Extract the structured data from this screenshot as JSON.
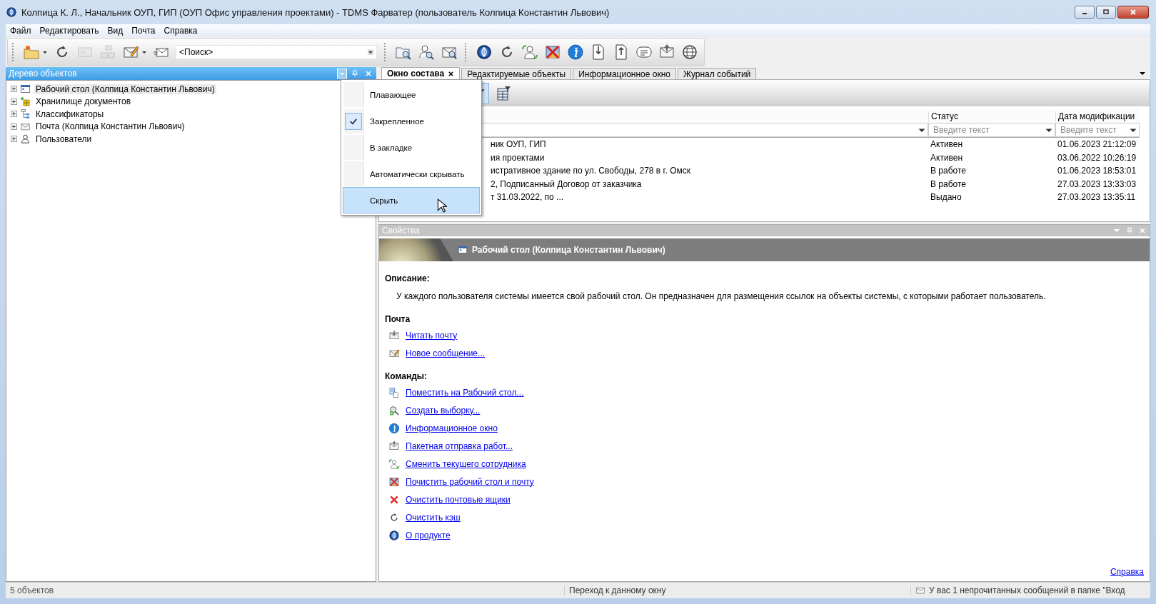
{
  "window": {
    "title": "Колпица К. Л., Начальник ОУП, ГИП (ОУП Офис управления проектами) - TDMS Фарватер (пользователь Колпица Константин Львович)"
  },
  "menu_bar": [
    "Файл",
    "Редактировать",
    "Вид",
    "Почта",
    "Справка"
  ],
  "toolbar": {
    "search": {
      "value": "<Поиск>"
    }
  },
  "object_tree": {
    "title": "Дерево объектов",
    "items": [
      {
        "label": "Рабочий стол (Колпица Константин Львович)",
        "selected": true,
        "expanded": false
      },
      {
        "label": "Хранилище документов",
        "selected": false,
        "expanded": false
      },
      {
        "label": "Классификаторы",
        "selected": false,
        "expanded": false
      },
      {
        "label": "Почта (Колпица Константин Львович)",
        "selected": false,
        "expanded": false
      },
      {
        "label": "Пользователи",
        "selected": false,
        "expanded": false
      }
    ]
  },
  "dock_menu": {
    "items": [
      {
        "label": "Плавающее",
        "checked": false,
        "selected": false
      },
      {
        "label": "Закрепленное",
        "checked": true,
        "selected": false
      },
      {
        "label": "В закладке",
        "checked": false,
        "selected": false
      },
      {
        "label": "Автоматически скрывать",
        "checked": false,
        "selected": false
      },
      {
        "label": "Скрыть",
        "checked": false,
        "selected": true
      }
    ]
  },
  "document_tabs": [
    {
      "label": "Окно состава",
      "selected": true
    },
    {
      "label": "Редактируемые объекты",
      "selected": false
    },
    {
      "label": "Информационное окно",
      "selected": false
    },
    {
      "label": "Журнал событий",
      "selected": false
    }
  ],
  "table": {
    "columns": [
      {
        "label": "Статус",
        "filter_placeholder": "Введите текст"
      },
      {
        "label": "Дата модификации",
        "filter_placeholder": "Введите текст"
      }
    ],
    "rows": [
      {
        "column_1": "ник ОУП, ГИП",
        "status": "Активен",
        "modified": "01.06.2023 21:12:09"
      },
      {
        "column_1": "ия проектами",
        "status": "Активен",
        "modified": "03.06.2022 10:26:19"
      },
      {
        "column_1": "истративное здание по ул. Свободы, 278 в г. Омск",
        "status": "В работе",
        "modified": "01.06.2023 18:53:01"
      },
      {
        "column_1": "2, Подписанный Договор от заказчика",
        "status": "В работе",
        "modified": "27.03.2023 13:33:03"
      },
      {
        "column_1": "т 31.03.2022, по ...",
        "status": "Выдано",
        "modified": "27.03.2023 13:35:11"
      }
    ]
  },
  "properties": {
    "title": "Свойства",
    "object_title": "Рабочий стол (Колпица Константин Львович)",
    "description_heading": "Описание:",
    "description": "У каждого пользователя системы имеется свой рабочий стол. Он предназначен для размещения ссылок на объекты системы, с которыми работает пользователь.",
    "mail_heading": "Почта",
    "mail_links": [
      "Читать почту",
      "Новое сообщение..."
    ],
    "commands_heading": "Команды:",
    "commands": [
      "Поместить на Рабочий стол...",
      "Создать выборку...",
      "Информационное окно",
      "Пакетная отправка работ...",
      "Сменить текущего сотрудника",
      "Почистить рабочий стол и почту",
      "Очистить почтовые ящики",
      "Очистить кэш",
      "О продукте"
    ],
    "help_link": "Справка"
  },
  "status_bar": {
    "count": "5 объектов",
    "hint": "Переход к данному окну",
    "message": "У вас 1 непрочитанных сообщений в папке \"Вход"
  }
}
